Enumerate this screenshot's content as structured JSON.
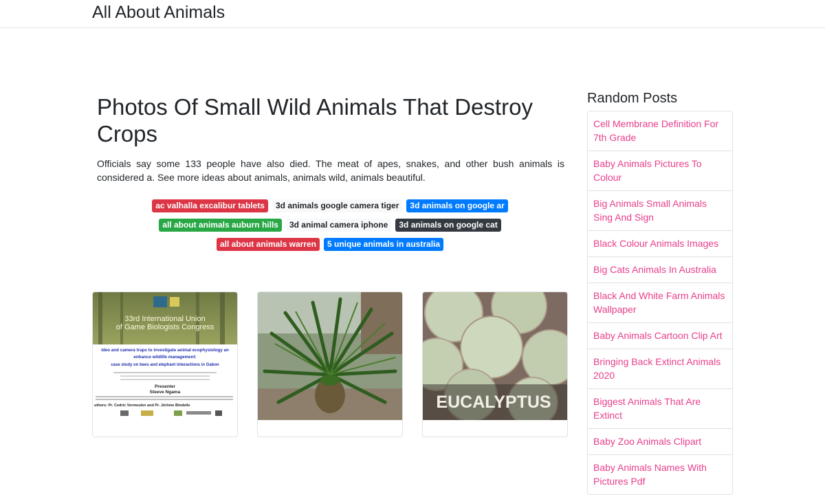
{
  "site": {
    "brand": "All About Animals"
  },
  "article": {
    "title": "Photos Of Small Wild Animals That Destroy Crops",
    "description": "Officials say some 133 people have also died. The meat of apes, snakes, and other bush animals is considered a. See more ideas about animals, animals wild, animals beautiful.",
    "tags": [
      {
        "label": "ac valhalla excalibur tablets",
        "bg": "#dc3545",
        "fg": "#ffffff"
      },
      {
        "label": "3d animals google camera tiger",
        "bg": "#f8f9fa",
        "fg": "#212529"
      },
      {
        "label": "3d animals on google ar",
        "bg": "#007bff",
        "fg": "#ffffff"
      },
      {
        "label": "all about animals auburn hills",
        "bg": "#28a745",
        "fg": "#ffffff"
      },
      {
        "label": "3d animal camera iphone",
        "bg": "#f8f9fa",
        "fg": "#212529"
      },
      {
        "label": "3d animals on google cat",
        "bg": "#343a40",
        "fg": "#ffffff"
      },
      {
        "label": "all about animals warren",
        "bg": "#dc3545",
        "fg": "#ffffff"
      },
      {
        "label": "5 unique animals in australia",
        "bg": "#007bff",
        "fg": "#ffffff"
      }
    ]
  },
  "cards": [
    {
      "name": "congress-poster",
      "lines": {
        "heading1": "33rd International Union",
        "heading2": "of Game Biologists Congress",
        "body1": "ideo and camera traps to investigate animal ecophysiology an",
        "body2": "enhance wildlife management:",
        "body3": "case study on bees and elephant interactions in Gabon",
        "presenter_label": "Presenter",
        "presenter_name": "Steeve Ngama",
        "authors": "uthors: Pr. Cedric Vermeulen and Pr. Jérôme Bindelle"
      }
    },
    {
      "name": "cycad-plant"
    },
    {
      "name": "eucalyptus-leaves",
      "lines": {
        "caption": "EUCALYPTUS"
      }
    }
  ],
  "sidebar": {
    "title": "Random Posts",
    "items": [
      "Cell Membrane Definition For 7th Grade",
      "Baby Animals Pictures To Colour",
      "Big Animals Small Animals Sing And Sign",
      "Black Colour Animals Images",
      "Big Cats Animals In Australia",
      "Black And White Farm Animals Wallpaper",
      "Baby Animals Cartoon Clip Art",
      "Bringing Back Extinct Animals 2020",
      "Biggest Animals That Are Extinct",
      "Baby Zoo Animals Clipart",
      "Baby Animals Names With Pictures Pdf"
    ]
  }
}
